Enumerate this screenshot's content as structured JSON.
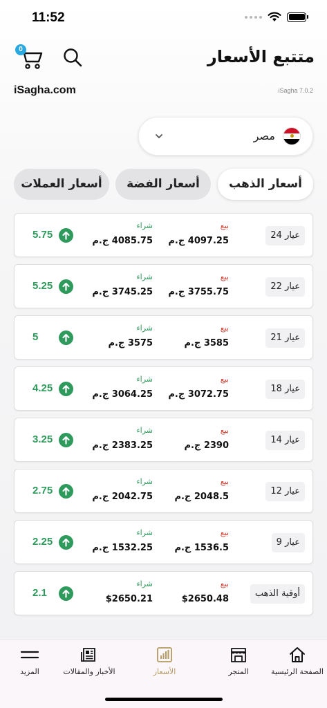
{
  "status_bar": {
    "time": "11:52"
  },
  "header": {
    "title": "متتبع الأسعار",
    "cart_count": "0"
  },
  "site": {
    "name": "iSagha.com",
    "version": "iSagha 7.0.2"
  },
  "country_selector": {
    "selected": "مصر"
  },
  "tabs": [
    {
      "label": "أسعار الذهب",
      "active": true
    },
    {
      "label": "أسعار الفضة",
      "active": false
    },
    {
      "label": "أسعار العملات",
      "active": false
    }
  ],
  "labels": {
    "sell": "بيع",
    "buy": "شراء"
  },
  "rows": [
    {
      "karat": "عيار 24",
      "sell": "4097.25 ج.م",
      "buy": "4085.75 ج.م",
      "change": "5.75"
    },
    {
      "karat": "عيار 22",
      "sell": "3755.75 ج.م",
      "buy": "3745.25 ج.م",
      "change": "5.25"
    },
    {
      "karat": "عيار 21",
      "sell": "3585 ج.م",
      "buy": "3575 ج.م",
      "change": "5"
    },
    {
      "karat": "عيار 18",
      "sell": "3072.75 ج.م",
      "buy": "3064.25 ج.م",
      "change": "4.25"
    },
    {
      "karat": "عيار 14",
      "sell": "2390 ج.م",
      "buy": "2383.25 ج.م",
      "change": "3.25"
    },
    {
      "karat": "عيار 12",
      "sell": "2048.5 ج.م",
      "buy": "2042.75 ج.م",
      "change": "2.75"
    },
    {
      "karat": "عيار 9",
      "sell": "1536.5 ج.م",
      "buy": "1532.25 ج.م",
      "change": "2.25"
    },
    {
      "karat": "أوقية الذهب",
      "sell": "$2650.48",
      "buy": "$2650.21",
      "change": "2.1"
    }
  ],
  "bottom_nav": {
    "home": "الصفحة الرئيسية",
    "store": "المتجر",
    "prices": "الأسعار",
    "news": "الأخبار والمقالات",
    "more": "المزيد"
  },
  "colors": {
    "accent_green": "#2e9a5b",
    "sell_red": "#d33a2c",
    "active_nav": "#b49a62",
    "badge_blue": "#2aa8e0"
  }
}
